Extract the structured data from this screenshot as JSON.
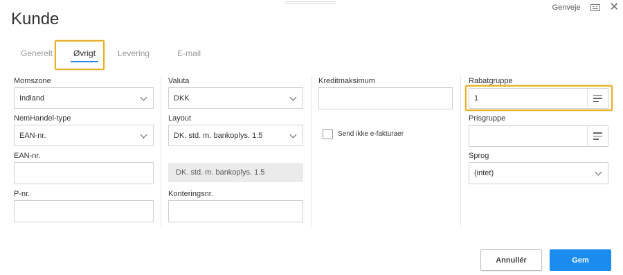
{
  "dialog": {
    "title": "Kunde",
    "shortcut_label": "Genveje"
  },
  "tabs": [
    {
      "label": "Generelt",
      "active": false
    },
    {
      "label": "Øvrigt",
      "active": true
    },
    {
      "label": "Levering",
      "active": false
    },
    {
      "label": "E-mail",
      "active": false
    }
  ],
  "fields": {
    "momszone": {
      "label": "Momszone",
      "value": "Indland"
    },
    "nemhandel_type": {
      "label": "NemHandel-type",
      "value": "EAN-nr."
    },
    "ean_nr": {
      "label": "EAN-nr.",
      "value": ""
    },
    "p_nr": {
      "label": "P-nr.",
      "value": ""
    },
    "valuta": {
      "label": "Valuta",
      "value": "DKK"
    },
    "layout": {
      "label": "Layout",
      "value": "DK. std. m. bankoplys. 1.5",
      "preview": "DK. std. m. bankoplys. 1.5"
    },
    "konteringsnr": {
      "label": "Konteringsnr.",
      "value": ""
    },
    "kreditmaksimum": {
      "label": "Kreditmaksimum",
      "value": ""
    },
    "send_ikke_efakturaer": {
      "label": "Send ikke e-fakturaer",
      "checked": false
    },
    "rabatgruppe": {
      "label": "Rabatgruppe",
      "value": "1"
    },
    "prisgruppe": {
      "label": "Prisgruppe",
      "value": ""
    },
    "sprog": {
      "label": "Sprog",
      "value": "(intet)"
    }
  },
  "buttons": {
    "cancel": "Annullér",
    "save": "Gem"
  },
  "colors": {
    "accent": "#1a8cf0",
    "highlight": "#e8b12b",
    "tab_underline": "#2b8ae6"
  }
}
